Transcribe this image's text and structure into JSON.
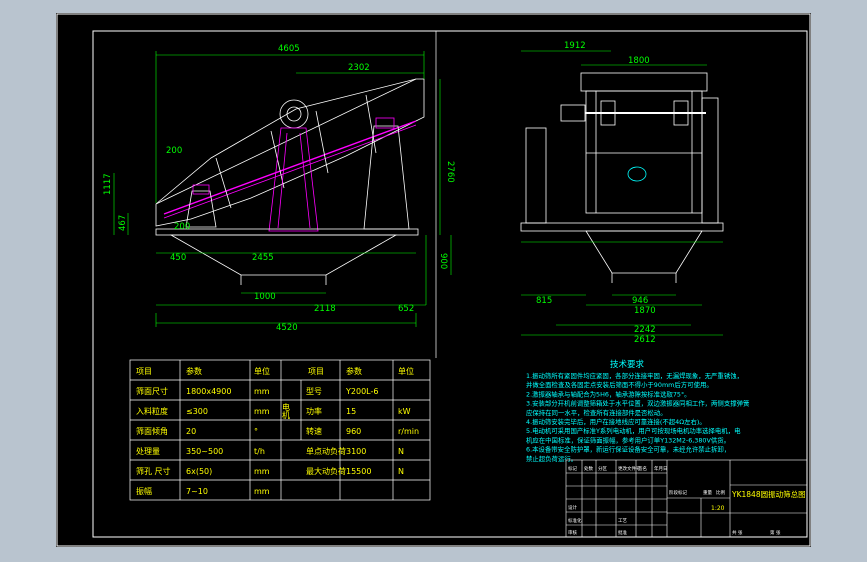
{
  "colors": {
    "background": "#b9c4cf",
    "sheet": "#000000",
    "frame": "#ffffff",
    "dimension": "#00ff00",
    "structure": "#ffffff",
    "highlight": "#ff00ff",
    "table_text": "#ffff00",
    "notes_text": "#00ffff",
    "accent": "#00ffff"
  },
  "front_view": {
    "dims": {
      "total_length": "4605",
      "upper_length": "2302",
      "height": "2760",
      "left_height": "1117",
      "feed_height": "467",
      "inlet_width": "200",
      "inlet_top": "200",
      "left_offset": "450",
      "support_span": "2455",
      "hopper_width": "1000",
      "hopper_depth": "900",
      "base_span": "2118",
      "right_offset": "652",
      "base_length": "4520"
    }
  },
  "side_view": {
    "dims": {
      "outer_top": "1912",
      "inner_top": "1800",
      "left_offset": "815",
      "outlet_width": "946",
      "frame_width": "1870",
      "base_width": "2242",
      "overall_width": "2612"
    }
  },
  "param_table": {
    "headers": [
      "项目",
      "参数",
      "单位",
      "项目",
      "参数",
      "单位"
    ],
    "motor_label": "电机",
    "rows": [
      {
        "item": "筛面尺寸",
        "value": "1800x4900",
        "unit": "mm",
        "item2": "型号",
        "value2": "Y200L-6",
        "unit2": ""
      },
      {
        "item": "入料粒度",
        "value": "≤300",
        "unit": "mm",
        "item2": "功率",
        "value2": "15",
        "unit2": "kW"
      },
      {
        "item": "筛面倾角",
        "value": "20",
        "unit": "°",
        "item2": "转速",
        "value2": "960",
        "unit2": "r/min"
      },
      {
        "item": "处理量",
        "value": "350~500",
        "unit": "t/h",
        "item2": "单点动负荷",
        "value2": "3100",
        "unit2": "N"
      },
      {
        "item": "筛孔 尺寸",
        "value": "6x(50)",
        "unit": "mm",
        "item2": "最大动负荷",
        "value2": "15500",
        "unit2": "N"
      },
      {
        "item": "振幅",
        "value": "7~10",
        "unit": "mm",
        "item2": "",
        "value2": "",
        "unit2": ""
      }
    ]
  },
  "notes": {
    "title": "技术要求",
    "lines": [
      "1.振动筛所有紧固件均应紧固，各部分连接牢固，无漏焊现象，无严重锈蚀，",
      "  并做全面检查及各固定点安装后筛面不得小于90mm后方可使用。",
      "2.激振器轴承与轴配合为5H6，轴承游隙按标准选取75°。",
      "3.安装部分开机前调整筛箱处于水平位置，双边激振器同相工作，两侧支撑弹簧",
      "  应保持在同一水平，检查所有连接部件是否松动。",
      "4.振动筛安装完毕后，用户在接地线应可靠连接(不超4Ω左右)。",
      "5.电动机可采用国产标准Y系列电动机，用户可按现场电机功率选择电机，电",
      "  机应在中国标准，保证筛面振幅，参考用户订单Y132M2-6,380V供货。",
      "6.本设备带安全防护罩，新运行保证设备安全可靠，未经允许禁止拆卸，",
      "  禁止超负荷运行。"
    ]
  },
  "title_block": {
    "drawing_title": "YK1848圆振动筛总图",
    "scale": "1:20",
    "labels": [
      "标记",
      "处数",
      "分区",
      "更改文件号",
      "签名",
      "年月日",
      "设计",
      "标准化",
      "审核",
      "工艺",
      "批准",
      "阶段标记",
      "重量",
      "比例",
      "共 张",
      "第 张"
    ]
  }
}
